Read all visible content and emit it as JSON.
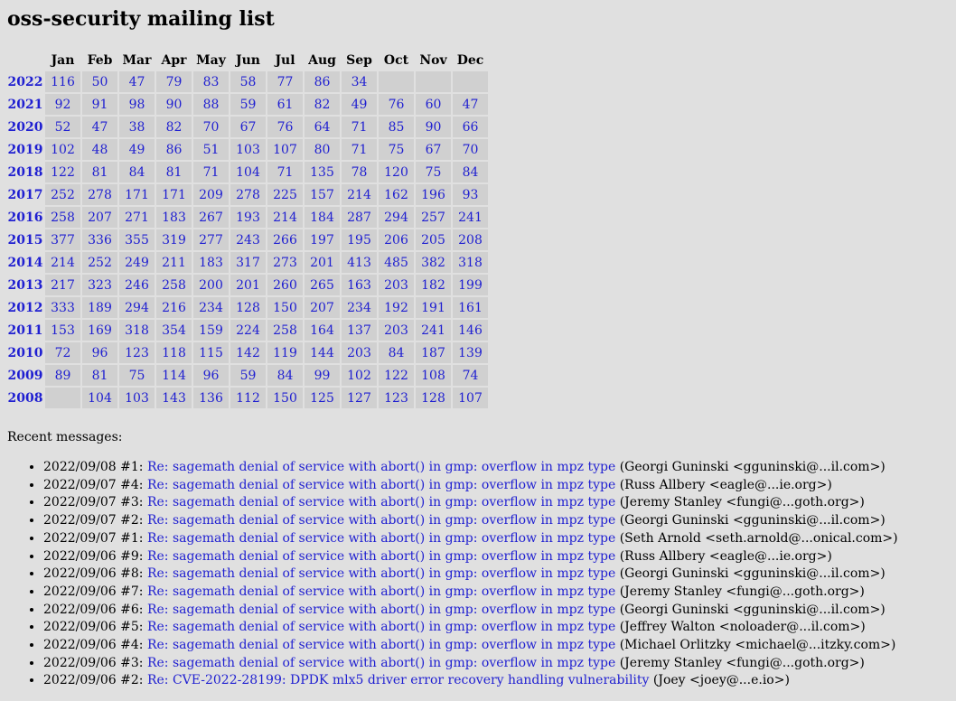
{
  "title": "oss-security mailing list",
  "months": [
    "Jan",
    "Feb",
    "Mar",
    "Apr",
    "May",
    "Jun",
    "Jul",
    "Aug",
    "Sep",
    "Oct",
    "Nov",
    "Dec"
  ],
  "years": [
    {
      "year": "2022",
      "counts": [
        "116",
        "50",
        "47",
        "79",
        "83",
        "58",
        "77",
        "86",
        "34",
        "",
        "",
        ""
      ]
    },
    {
      "year": "2021",
      "counts": [
        "92",
        "91",
        "98",
        "90",
        "88",
        "59",
        "61",
        "82",
        "49",
        "76",
        "60",
        "47"
      ]
    },
    {
      "year": "2020",
      "counts": [
        "52",
        "47",
        "38",
        "82",
        "70",
        "67",
        "76",
        "64",
        "71",
        "85",
        "90",
        "66"
      ]
    },
    {
      "year": "2019",
      "counts": [
        "102",
        "48",
        "49",
        "86",
        "51",
        "103",
        "107",
        "80",
        "71",
        "75",
        "67",
        "70"
      ]
    },
    {
      "year": "2018",
      "counts": [
        "122",
        "81",
        "84",
        "81",
        "71",
        "104",
        "71",
        "135",
        "78",
        "120",
        "75",
        "84"
      ]
    },
    {
      "year": "2017",
      "counts": [
        "252",
        "278",
        "171",
        "171",
        "209",
        "278",
        "225",
        "157",
        "214",
        "162",
        "196",
        "93"
      ]
    },
    {
      "year": "2016",
      "counts": [
        "258",
        "207",
        "271",
        "183",
        "267",
        "193",
        "214",
        "184",
        "287",
        "294",
        "257",
        "241"
      ]
    },
    {
      "year": "2015",
      "counts": [
        "377",
        "336",
        "355",
        "319",
        "277",
        "243",
        "266",
        "197",
        "195",
        "206",
        "205",
        "208"
      ]
    },
    {
      "year": "2014",
      "counts": [
        "214",
        "252",
        "249",
        "211",
        "183",
        "317",
        "273",
        "201",
        "413",
        "485",
        "382",
        "318"
      ]
    },
    {
      "year": "2013",
      "counts": [
        "217",
        "323",
        "246",
        "258",
        "200",
        "201",
        "260",
        "265",
        "163",
        "203",
        "182",
        "199"
      ]
    },
    {
      "year": "2012",
      "counts": [
        "333",
        "189",
        "294",
        "216",
        "234",
        "128",
        "150",
        "207",
        "234",
        "192",
        "191",
        "161"
      ]
    },
    {
      "year": "2011",
      "counts": [
        "153",
        "169",
        "318",
        "354",
        "159",
        "224",
        "258",
        "164",
        "137",
        "203",
        "241",
        "146"
      ]
    },
    {
      "year": "2010",
      "counts": [
        "72",
        "96",
        "123",
        "118",
        "115",
        "142",
        "119",
        "144",
        "203",
        "84",
        "187",
        "139"
      ]
    },
    {
      "year": "2009",
      "counts": [
        "89",
        "81",
        "75",
        "114",
        "96",
        "59",
        "84",
        "99",
        "102",
        "122",
        "108",
        "74"
      ]
    },
    {
      "year": "2008",
      "counts": [
        "",
        "104",
        "103",
        "143",
        "136",
        "112",
        "150",
        "125",
        "127",
        "123",
        "128",
        "107"
      ]
    }
  ],
  "recent_label": "Recent messages:",
  "messages": [
    {
      "date": "2022/09/08 #1:",
      "subject": "Re: sagemath denial of service with abort() in gmp: overflow in mpz type",
      "author": "(Georgi Guninski <gguninski@...il.com>)"
    },
    {
      "date": "2022/09/07 #4:",
      "subject": "Re: sagemath denial of service with abort() in gmp: overflow in mpz type",
      "author": "(Russ Allbery <eagle@...ie.org>)"
    },
    {
      "date": "2022/09/07 #3:",
      "subject": "Re: sagemath denial of service with abort() in gmp: overflow in mpz type",
      "author": "(Jeremy Stanley <fungi@...goth.org>)"
    },
    {
      "date": "2022/09/07 #2:",
      "subject": "Re: sagemath denial of service with abort() in gmp: overflow in mpz type",
      "author": "(Georgi Guninski <gguninski@...il.com>)"
    },
    {
      "date": "2022/09/07 #1:",
      "subject": "Re: sagemath denial of service with abort() in gmp: overflow in mpz type",
      "author": "(Seth Arnold <seth.arnold@...onical.com>)"
    },
    {
      "date": "2022/09/06 #9:",
      "subject": "Re: sagemath denial of service with abort() in gmp: overflow in mpz type",
      "author": "(Russ Allbery <eagle@...ie.org>)"
    },
    {
      "date": "2022/09/06 #8:",
      "subject": "Re: sagemath denial of service with abort() in gmp: overflow in mpz type",
      "author": "(Georgi Guninski <gguninski@...il.com>)"
    },
    {
      "date": "2022/09/06 #7:",
      "subject": "Re: sagemath denial of service with abort() in gmp: overflow in mpz type",
      "author": "(Jeremy Stanley <fungi@...goth.org>)"
    },
    {
      "date": "2022/09/06 #6:",
      "subject": "Re: sagemath denial of service with abort() in gmp: overflow in mpz type",
      "author": "(Georgi Guninski <gguninski@...il.com>)"
    },
    {
      "date": "2022/09/06 #5:",
      "subject": "Re: sagemath denial of service with abort() in gmp: overflow in mpz type",
      "author": "(Jeffrey Walton <noloader@...il.com>)"
    },
    {
      "date": "2022/09/06 #4:",
      "subject": "Re: sagemath denial of service with abort() in gmp: overflow in mpz type",
      "author": "(Michael Orlitzky <michael@...itzky.com>)"
    },
    {
      "date": "2022/09/06 #3:",
      "subject": "Re: sagemath denial of service with abort() in gmp: overflow in mpz type",
      "author": "(Jeremy Stanley <fungi@...goth.org>)"
    },
    {
      "date": "2022/09/06 #2:",
      "subject": "Re: CVE-2022-28199: DPDK mlx5 driver error recovery handling vulnerability",
      "author": "(Joey <joey@...e.io>)"
    }
  ],
  "colors": {
    "link": "#1f1fd1",
    "background": "#e0e0e0",
    "cell": "#d0d0d0"
  }
}
